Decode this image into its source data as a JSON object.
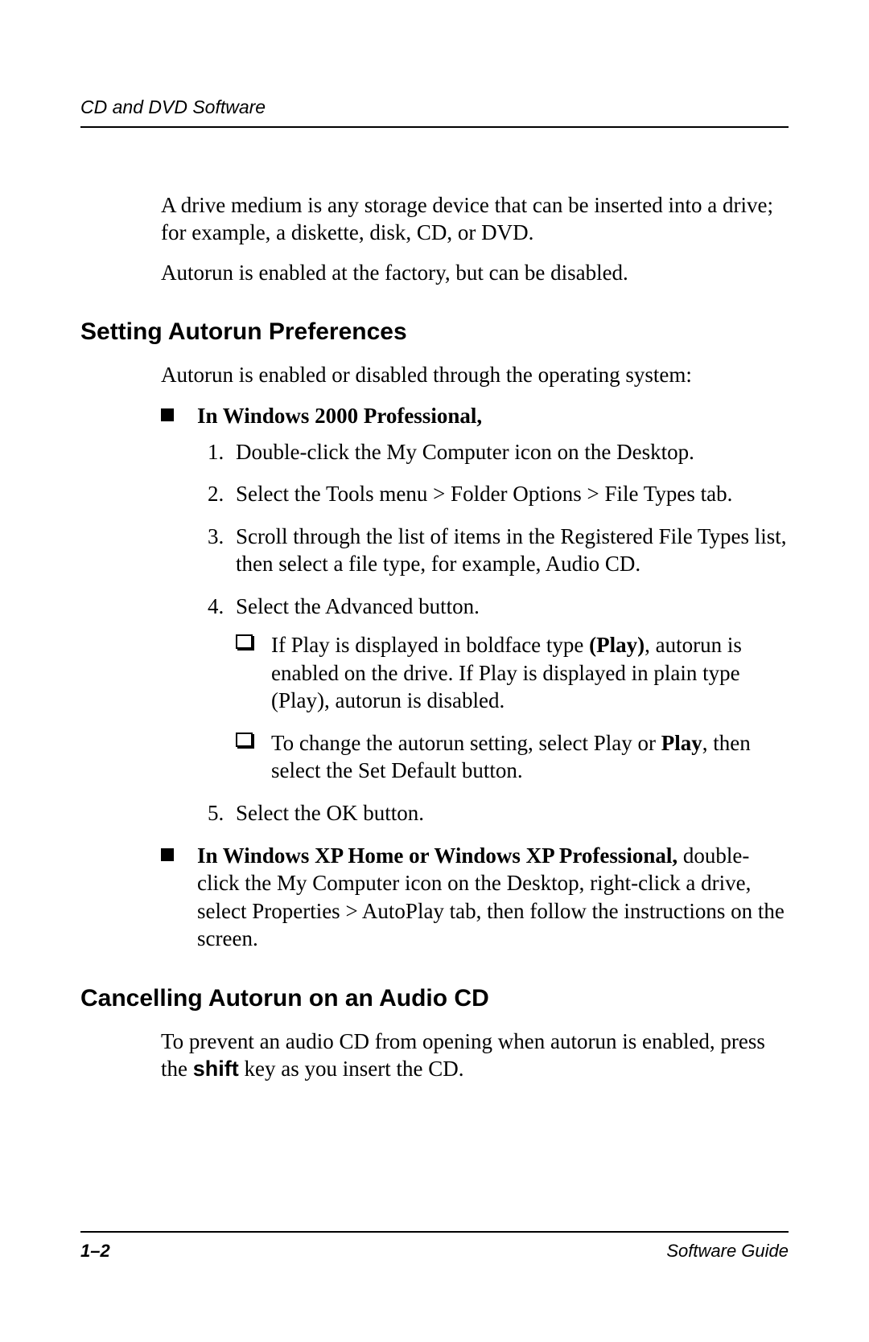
{
  "header": {
    "running_head": "CD and DVD Software"
  },
  "intro": {
    "p1": "A drive medium is any storage device that can be inserted into a drive; for example, a diskette, disk, CD, or DVD.",
    "p2": "Autorun is enabled at the factory, but can be disabled."
  },
  "section1": {
    "heading": "Setting Autorun Preferences",
    "p1": "Autorun is enabled or disabled through the operating system:",
    "bullets": {
      "b1_lead": "In Windows 2000 Professional,",
      "steps": {
        "s1": "Double-click the My Computer icon on the Desktop.",
        "s2": "Select the Tools menu > Folder Options > File Types tab.",
        "s3": "Scroll through the list of items in the Registered File Types list, then select a file type, for example, Audio CD.",
        "s4": "Select the Advanced button.",
        "sub": {
          "a_pre": "If Play is displayed in boldface type ",
          "a_bold": "(Play)",
          "a_post": ", autorun is enabled on the drive. If Play is displayed in plain type (Play), autorun is disabled.",
          "b_pre": "To change the autorun setting, select Play or ",
          "b_bold": "Play",
          "b_post": ", then select the Set Default button."
        },
        "s5": "Select the OK button."
      },
      "b2_lead": "In Windows XP Home or Windows XP Professional,",
      "b2_rest": " double-click the My Computer icon on the Desktop, right-click a drive, select Properties > AutoPlay tab, then follow the instructions on the screen."
    }
  },
  "section2": {
    "heading": "Cancelling Autorun on an Audio CD",
    "p1_pre": "To prevent an audio CD from opening when autorun is enabled, press the ",
    "p1_bold": "shift",
    "p1_post": " key as you insert the CD."
  },
  "footer": {
    "page": "1–2",
    "guide": "Software Guide"
  }
}
